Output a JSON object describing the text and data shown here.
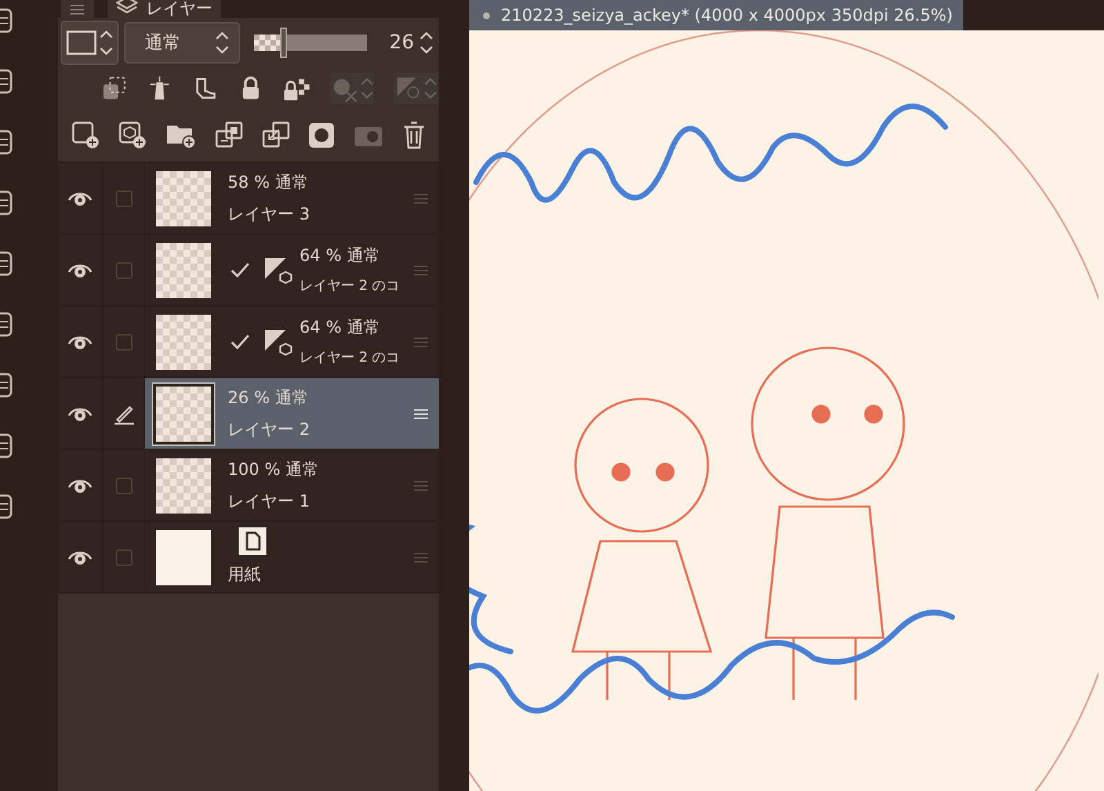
{
  "layer_panel": {
    "tab_label": "レイヤー",
    "blend_mode": "通常",
    "opacity_value": "26",
    "opacity_slider": {
      "level": 0.26
    }
  },
  "layers": [
    {
      "kind": "raster",
      "opacity_mode": "58 % 通常",
      "name": "レイヤー 3",
      "visible": true,
      "selected": false,
      "clipped": false
    },
    {
      "kind": "model",
      "opacity_mode": "64 % 通常",
      "name": "レイヤー 2 のコ",
      "visible": true,
      "selected": false,
      "clipped": true
    },
    {
      "kind": "model",
      "opacity_mode": "64 % 通常",
      "name": "レイヤー 2 のコ",
      "visible": true,
      "selected": false,
      "clipped": true
    },
    {
      "kind": "raster",
      "opacity_mode": "26 % 通常",
      "name": "レイヤー 2",
      "visible": true,
      "selected": true,
      "clipped": false
    },
    {
      "kind": "raster",
      "opacity_mode": "100 % 通常",
      "name": "レイヤー 1",
      "visible": true,
      "selected": false,
      "clipped": false
    },
    {
      "kind": "paper",
      "name": "用紙",
      "visible": true,
      "selected": false
    }
  ],
  "document_tab": {
    "title": "210223_seizya_ackey* (4000 x 4000px 350dpi 26.5%)"
  }
}
